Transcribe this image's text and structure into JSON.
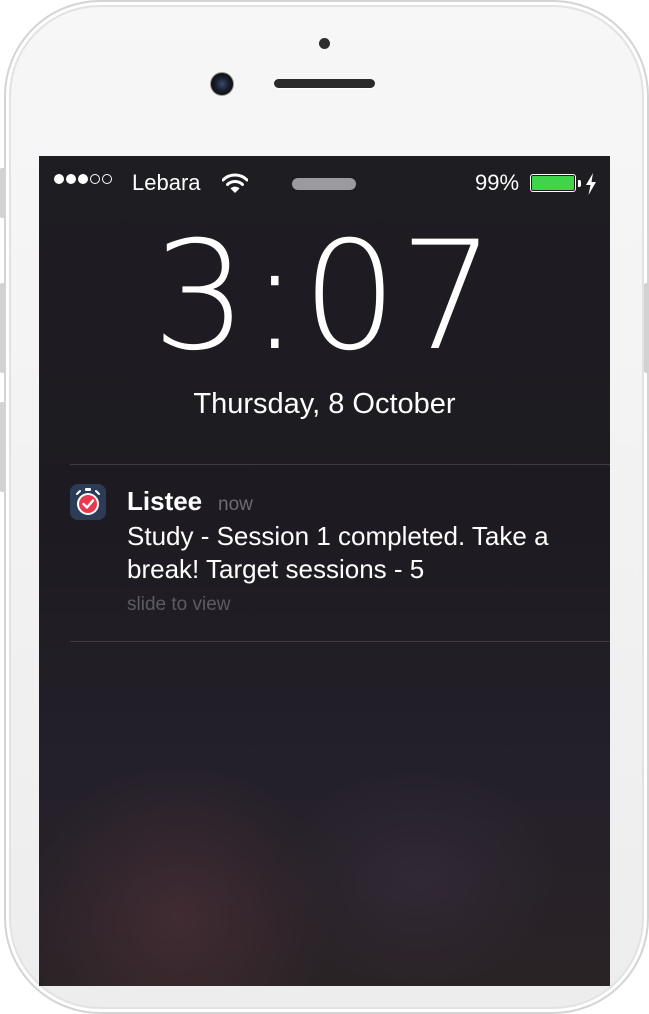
{
  "status_bar": {
    "signal_bars_total": 5,
    "signal_bars_filled": 3,
    "carrier": "Lebara",
    "wifi_icon": "wifi-icon",
    "battery_percent": "99%",
    "battery_level": 0.99,
    "battery_color": "#3fd44a",
    "charging_icon": "bolt-icon"
  },
  "lock_screen": {
    "time": "3:07",
    "date": "Thursday, 8 October"
  },
  "notification": {
    "app_name": "Listee",
    "time_ago": "now",
    "message": "Study - Session 1 completed. Take a break! Target sessions - 5",
    "hint": "slide to view",
    "app_icon": "stopwatch-icon",
    "icon_accent": "#e8384f"
  }
}
